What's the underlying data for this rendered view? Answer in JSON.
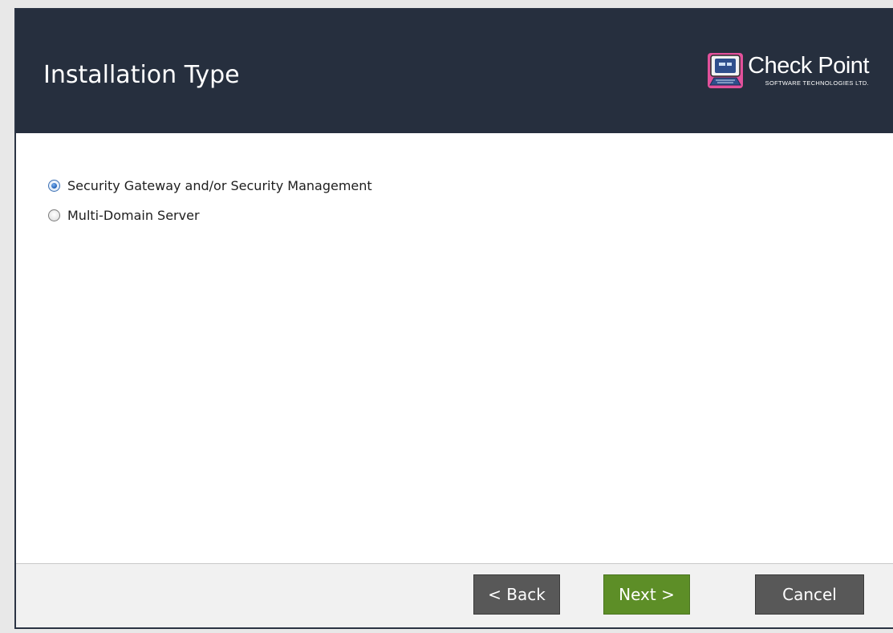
{
  "header": {
    "title": "Installation Type",
    "logo": {
      "name": "Check Point",
      "tagline": "SOFTWARE TECHNOLOGIES LTD."
    }
  },
  "options": [
    {
      "label": "Security Gateway and/or Security Management",
      "selected": true
    },
    {
      "label": "Multi-Domain Server",
      "selected": false
    }
  ],
  "footer": {
    "back_label": "< Back",
    "next_label": "Next >",
    "cancel_label": "Cancel"
  },
  "colors": {
    "header_bg": "#262f3e",
    "next_button": "#5d8e27",
    "secondary_button": "#585858"
  }
}
